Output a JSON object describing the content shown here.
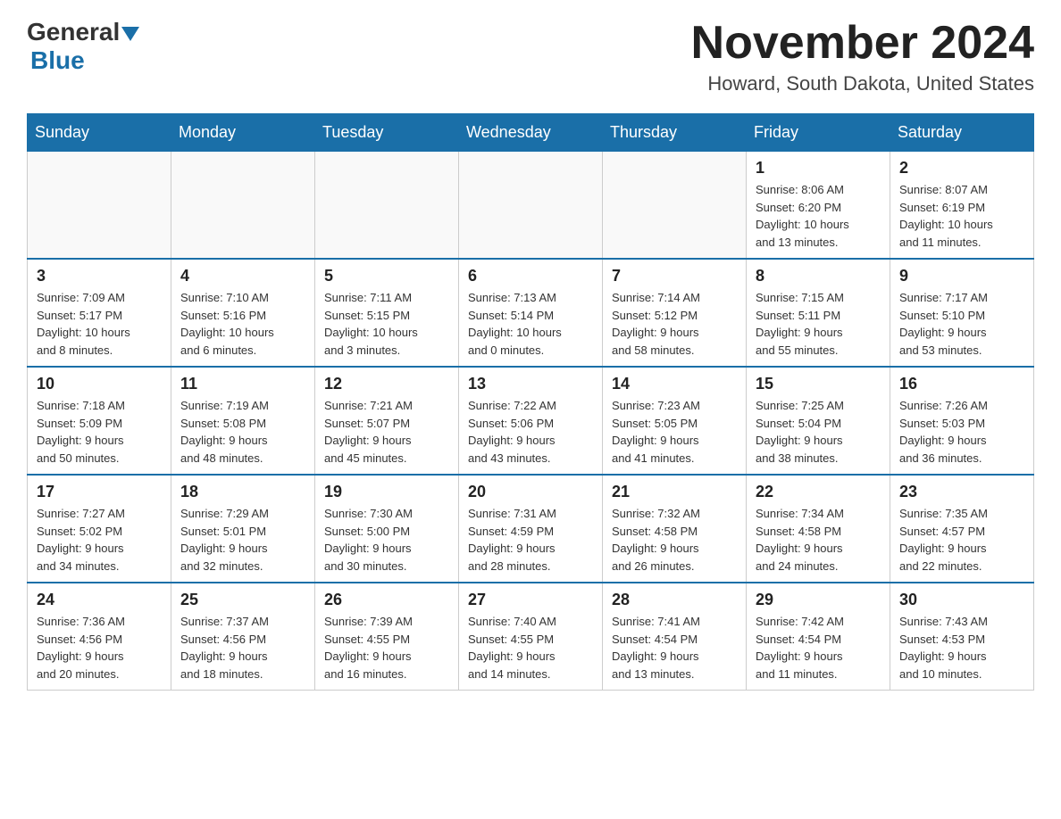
{
  "header": {
    "logo_general": "General",
    "logo_blue": "Blue",
    "title": "November 2024",
    "subtitle": "Howard, South Dakota, United States"
  },
  "weekdays": [
    "Sunday",
    "Monday",
    "Tuesday",
    "Wednesday",
    "Thursday",
    "Friday",
    "Saturday"
  ],
  "weeks": [
    [
      {
        "day": "",
        "info": ""
      },
      {
        "day": "",
        "info": ""
      },
      {
        "day": "",
        "info": ""
      },
      {
        "day": "",
        "info": ""
      },
      {
        "day": "",
        "info": ""
      },
      {
        "day": "1",
        "info": "Sunrise: 8:06 AM\nSunset: 6:20 PM\nDaylight: 10 hours\nand 13 minutes."
      },
      {
        "day": "2",
        "info": "Sunrise: 8:07 AM\nSunset: 6:19 PM\nDaylight: 10 hours\nand 11 minutes."
      }
    ],
    [
      {
        "day": "3",
        "info": "Sunrise: 7:09 AM\nSunset: 5:17 PM\nDaylight: 10 hours\nand 8 minutes."
      },
      {
        "day": "4",
        "info": "Sunrise: 7:10 AM\nSunset: 5:16 PM\nDaylight: 10 hours\nand 6 minutes."
      },
      {
        "day": "5",
        "info": "Sunrise: 7:11 AM\nSunset: 5:15 PM\nDaylight: 10 hours\nand 3 minutes."
      },
      {
        "day": "6",
        "info": "Sunrise: 7:13 AM\nSunset: 5:14 PM\nDaylight: 10 hours\nand 0 minutes."
      },
      {
        "day": "7",
        "info": "Sunrise: 7:14 AM\nSunset: 5:12 PM\nDaylight: 9 hours\nand 58 minutes."
      },
      {
        "day": "8",
        "info": "Sunrise: 7:15 AM\nSunset: 5:11 PM\nDaylight: 9 hours\nand 55 minutes."
      },
      {
        "day": "9",
        "info": "Sunrise: 7:17 AM\nSunset: 5:10 PM\nDaylight: 9 hours\nand 53 minutes."
      }
    ],
    [
      {
        "day": "10",
        "info": "Sunrise: 7:18 AM\nSunset: 5:09 PM\nDaylight: 9 hours\nand 50 minutes."
      },
      {
        "day": "11",
        "info": "Sunrise: 7:19 AM\nSunset: 5:08 PM\nDaylight: 9 hours\nand 48 minutes."
      },
      {
        "day": "12",
        "info": "Sunrise: 7:21 AM\nSunset: 5:07 PM\nDaylight: 9 hours\nand 45 minutes."
      },
      {
        "day": "13",
        "info": "Sunrise: 7:22 AM\nSunset: 5:06 PM\nDaylight: 9 hours\nand 43 minutes."
      },
      {
        "day": "14",
        "info": "Sunrise: 7:23 AM\nSunset: 5:05 PM\nDaylight: 9 hours\nand 41 minutes."
      },
      {
        "day": "15",
        "info": "Sunrise: 7:25 AM\nSunset: 5:04 PM\nDaylight: 9 hours\nand 38 minutes."
      },
      {
        "day": "16",
        "info": "Sunrise: 7:26 AM\nSunset: 5:03 PM\nDaylight: 9 hours\nand 36 minutes."
      }
    ],
    [
      {
        "day": "17",
        "info": "Sunrise: 7:27 AM\nSunset: 5:02 PM\nDaylight: 9 hours\nand 34 minutes."
      },
      {
        "day": "18",
        "info": "Sunrise: 7:29 AM\nSunset: 5:01 PM\nDaylight: 9 hours\nand 32 minutes."
      },
      {
        "day": "19",
        "info": "Sunrise: 7:30 AM\nSunset: 5:00 PM\nDaylight: 9 hours\nand 30 minutes."
      },
      {
        "day": "20",
        "info": "Sunrise: 7:31 AM\nSunset: 4:59 PM\nDaylight: 9 hours\nand 28 minutes."
      },
      {
        "day": "21",
        "info": "Sunrise: 7:32 AM\nSunset: 4:58 PM\nDaylight: 9 hours\nand 26 minutes."
      },
      {
        "day": "22",
        "info": "Sunrise: 7:34 AM\nSunset: 4:58 PM\nDaylight: 9 hours\nand 24 minutes."
      },
      {
        "day": "23",
        "info": "Sunrise: 7:35 AM\nSunset: 4:57 PM\nDaylight: 9 hours\nand 22 minutes."
      }
    ],
    [
      {
        "day": "24",
        "info": "Sunrise: 7:36 AM\nSunset: 4:56 PM\nDaylight: 9 hours\nand 20 minutes."
      },
      {
        "day": "25",
        "info": "Sunrise: 7:37 AM\nSunset: 4:56 PM\nDaylight: 9 hours\nand 18 minutes."
      },
      {
        "day": "26",
        "info": "Sunrise: 7:39 AM\nSunset: 4:55 PM\nDaylight: 9 hours\nand 16 minutes."
      },
      {
        "day": "27",
        "info": "Sunrise: 7:40 AM\nSunset: 4:55 PM\nDaylight: 9 hours\nand 14 minutes."
      },
      {
        "day": "28",
        "info": "Sunrise: 7:41 AM\nSunset: 4:54 PM\nDaylight: 9 hours\nand 13 minutes."
      },
      {
        "day": "29",
        "info": "Sunrise: 7:42 AM\nSunset: 4:54 PM\nDaylight: 9 hours\nand 11 minutes."
      },
      {
        "day": "30",
        "info": "Sunrise: 7:43 AM\nSunset: 4:53 PM\nDaylight: 9 hours\nand 10 minutes."
      }
    ]
  ]
}
